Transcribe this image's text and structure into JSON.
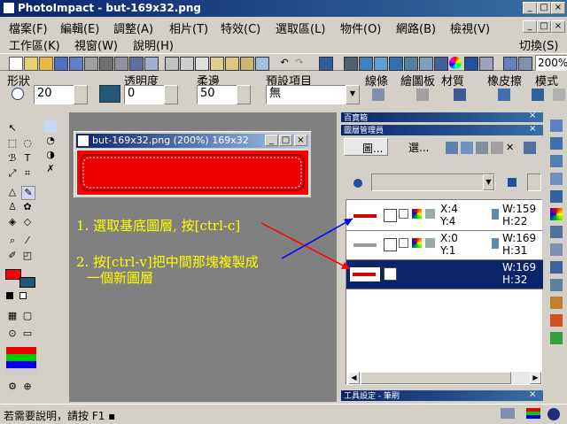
{
  "app": {
    "title": "PhotoImpact - but-169x32.png",
    "window_buttons": [
      "_",
      "□",
      "×"
    ]
  },
  "menus": {
    "row1": [
      "檔案(F)",
      "編輯(E)",
      "調整(A)",
      "相片(T)",
      "特效(C)",
      "選取區(L)",
      "物件(O)",
      "網路(B)",
      "檢視(V)"
    ],
    "row2": [
      "工作區(K)",
      "視窗(W)",
      "說明(H)"
    ],
    "switch": "切換(S)",
    "inner_window_buttons": [
      "_",
      "□",
      "×"
    ]
  },
  "toolbar": {
    "zoom": "200%"
  },
  "attributes": {
    "shape_label": "形狀",
    "opacity_label": "透明度",
    "softedge_label": "柔邊",
    "preset_label": "預設項目",
    "size_value": "20",
    "opacity_value": "0",
    "softedge_value": "50",
    "preset_value": "無",
    "right_labels": [
      "線條",
      "繪圖板",
      "材質",
      "橡皮擦",
      "模式"
    ]
  },
  "document": {
    "title": "but-169x32.png (200%) 169x32",
    "button_fill": "#ff0000"
  },
  "panels": {
    "treasure_title": "百寶箱",
    "layer_title": "圖層管理員",
    "layer_tabs": [
      "圖...",
      "選..."
    ],
    "tool_settings_title": "工具設定 - 筆刷",
    "layers": [
      {
        "x": "X:4",
        "y": "Y:4",
        "w": "W:159",
        "h": "H:22",
        "color": "#dd0000"
      },
      {
        "x": "X:0",
        "y": "Y:1",
        "w": "W:169",
        "h": "H:31",
        "color": "#999999"
      },
      {
        "x": "",
        "y": "",
        "w": "W:169",
        "h": "H:32",
        "color": "#dd0000"
      }
    ]
  },
  "annotations": {
    "step1": "1. 選取基底圖層, 按[ctrl-c]",
    "step2_line1": "2. 按[ctrl-v]把中間那塊複製成",
    "step2_line2": "一個新圖層",
    "arrow_color": "#ff0000",
    "arrow2_color": "#0000ff"
  },
  "status": {
    "help_text": "若需要說明，請按 F1 ▪"
  }
}
